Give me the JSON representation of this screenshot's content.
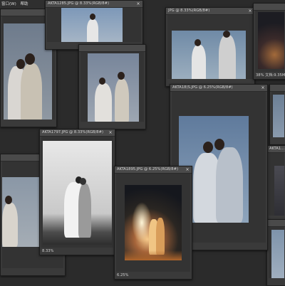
{
  "menubar": {
    "items": [
      "窗口(W)",
      "帮助"
    ]
  },
  "windows": {
    "w1": {
      "title": "",
      "status": ""
    },
    "w2": {
      "title": "AKTA1285.JPG @ 8.33%(RGB/8#)",
      "status": ""
    },
    "w3": {
      "title": "JPG @ 8.33%(RGB/8#)",
      "status": ""
    },
    "w4": {
      "title": "",
      "status": "38% 文档:9.35M/9.35M"
    },
    "w5": {
      "title": "",
      "status": ""
    },
    "w6": {
      "title": "AKTA18(S.JPG @ 6.25%(RGB/8#)",
      "status": ""
    },
    "w7": {
      "title": "AKTA1797.JPG @ 8.33%(RGB/8#)",
      "status": "8.33%"
    },
    "w8": {
      "title": "AKTA1895.JPG @ 6.25%(RGB/8#)",
      "status": "6.25%"
    },
    "w9": {
      "title": "",
      "status": ""
    },
    "w10": {
      "title": "AKTA1...",
      "status": ""
    },
    "w11": {
      "title": "",
      "status": ""
    },
    "w12": {
      "title": "",
      "status": ""
    }
  },
  "colors": {
    "app_background": "#2b2b2b",
    "window_frame": "#3a3a3a",
    "title_bar": "#4a4a4a"
  }
}
